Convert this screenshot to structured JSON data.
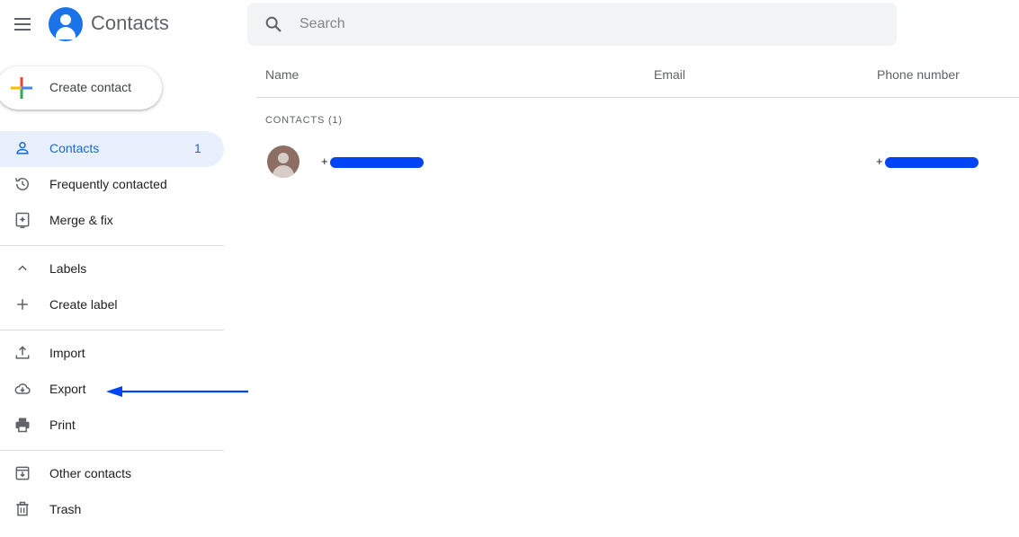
{
  "header": {
    "app_title": "Contacts",
    "menu_icon": "hamburger-menu-icon",
    "logo_icon": "contacts-logo-icon"
  },
  "search": {
    "placeholder": "Search",
    "value": ""
  },
  "create_button": {
    "label": "Create contact",
    "icon": "multicolor-plus-icon"
  },
  "sidebar": {
    "items": [
      {
        "label": "Contacts",
        "count": "1",
        "icon": "person-icon",
        "active": true
      },
      {
        "label": "Frequently contacted",
        "icon": "history-icon"
      },
      {
        "label": "Merge & fix",
        "icon": "merge-fix-icon"
      },
      {
        "label": "Labels",
        "icon": "chevron-up-icon"
      },
      {
        "label": "Create label",
        "icon": "plus-icon"
      },
      {
        "label": "Import",
        "icon": "upload-icon"
      },
      {
        "label": "Export",
        "icon": "cloud-download-icon"
      },
      {
        "label": "Print",
        "icon": "printer-icon"
      },
      {
        "label": "Other contacts",
        "icon": "archive-icon"
      },
      {
        "label": "Trash",
        "icon": "trash-icon"
      }
    ]
  },
  "table": {
    "columns": [
      "Name",
      "Email",
      "Phone number"
    ],
    "section_label": "CONTACTS (1)",
    "rows": [
      {
        "name_prefix": "+",
        "email": "",
        "phone_prefix": "+"
      }
    ]
  },
  "colors": {
    "accent": "#1a73e8",
    "active_bg": "#e8f0fe",
    "active_text": "#1967d2",
    "redaction": "#0045f5",
    "annotation_arrow": "#0045f5"
  }
}
